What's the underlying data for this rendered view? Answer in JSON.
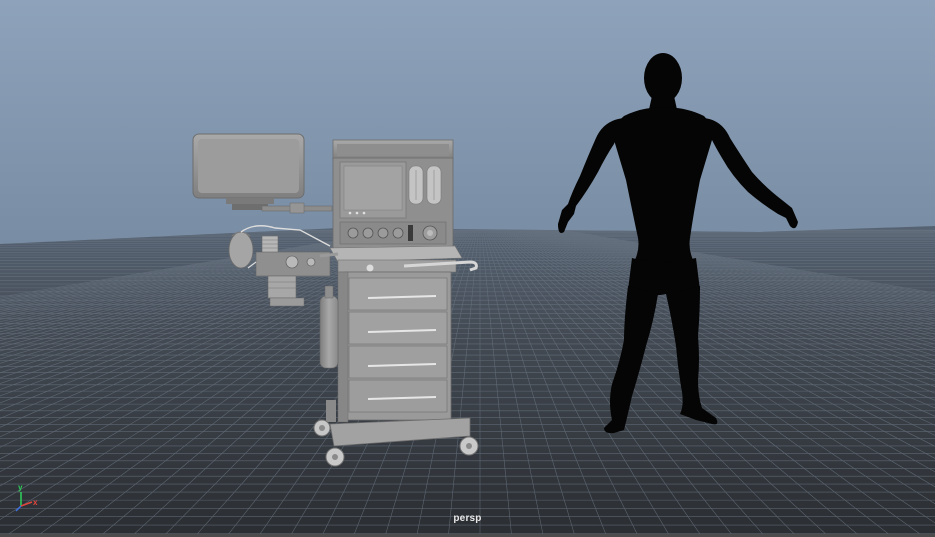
{
  "viewport": {
    "camera_name": "persp",
    "axis_gizmo": {
      "x": "x",
      "y": "y"
    }
  },
  "scene": {
    "objects": [
      {
        "name": "anesthesia-machine",
        "description_icon": "machine"
      },
      {
        "name": "human-silhouette",
        "description_icon": "human"
      }
    ]
  },
  "colors": {
    "sky_top": "#8ea3bb",
    "sky_horizon": "#5e7188",
    "grid_far": "#566373",
    "grid_near": "#2a2d31",
    "grid_line": "#6b7683",
    "model_gray": "#9a9a9a",
    "silhouette": "#050505"
  }
}
